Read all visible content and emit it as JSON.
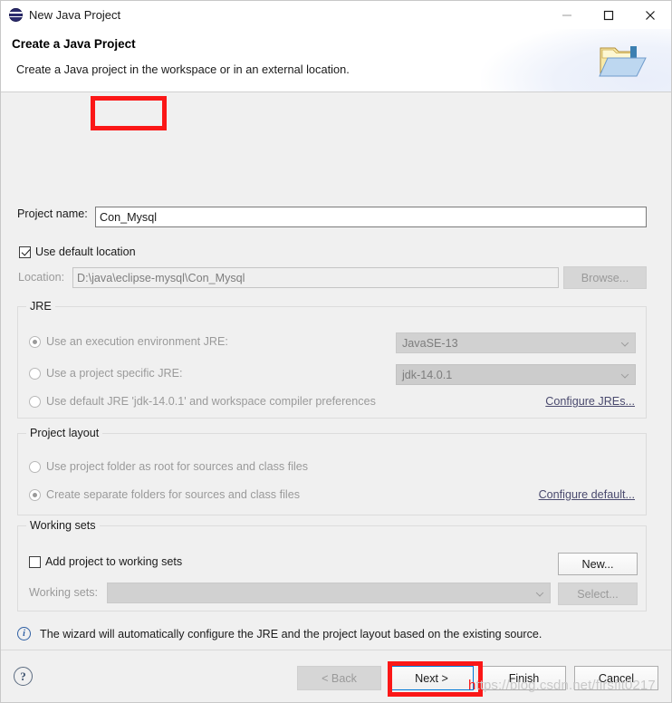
{
  "window": {
    "title": "New Java Project",
    "icon": "eclipse-icon",
    "minimize_label": "—",
    "maximize_label": "□",
    "close_label": "✕"
  },
  "header": {
    "title": "Create a Java Project",
    "subtitle": "Create a Java project in the workspace or in an external location.",
    "icon": "new-java-project-folder-icon"
  },
  "form": {
    "project_name_label": "Project name:",
    "project_name_value": "Con_Mysql",
    "use_default_location_label": "Use default location",
    "use_default_location_checked": true,
    "location_label": "Location:",
    "location_value": "D:\\java\\eclipse-mysql\\Con_Mysql",
    "browse_label": "Browse..."
  },
  "jre": {
    "group_title": "JRE",
    "option_execution_env": "Use an execution environment JRE:",
    "execution_env_value": "JavaSE-13",
    "option_project_specific": "Use a project specific JRE:",
    "project_specific_value": "jdk-14.0.1",
    "option_default_jre": "Use default JRE 'jdk-14.0.1' and workspace compiler preferences",
    "configure_link": "Configure JREs...",
    "selected": "execution_env"
  },
  "project_layout": {
    "group_title": "Project layout",
    "option_project_folder_root": "Use project folder as root for sources and class files",
    "option_separate_folders": "Create separate folders for sources and class files",
    "configure_link": "Configure default...",
    "selected": "separate_folders"
  },
  "working_sets": {
    "group_title": "Working sets",
    "add_project_label": "Add project to working sets",
    "add_project_checked": false,
    "new_label": "New...",
    "working_sets_label": "Working sets:",
    "working_sets_value": "",
    "select_label": "Select..."
  },
  "info": {
    "icon": "info-icon",
    "message": "The wizard will automatically configure the JRE and the project layout based on the existing source."
  },
  "footer": {
    "help_label": "?",
    "back_label": "< Back",
    "next_label": "Next >",
    "finish_label": "Finish",
    "cancel_label": "Cancel"
  },
  "annotations": {
    "color": "#fb1717",
    "targets": [
      "project-name-input",
      "next-button"
    ]
  },
  "watermark": {
    "text_prefix": "h",
    "text": "ttps://blog.csdn.net/firsfit0217"
  }
}
